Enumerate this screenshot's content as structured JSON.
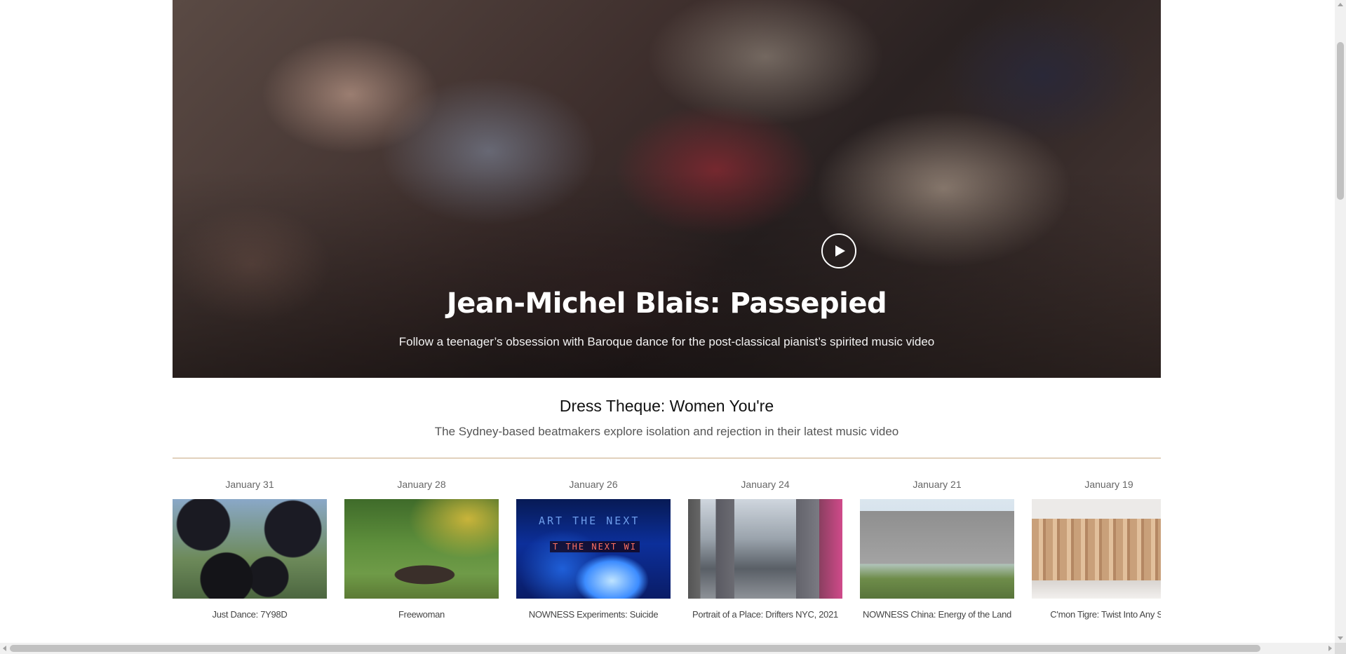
{
  "hero": {
    "title": "Jean-Michel Blais: Passepied",
    "subtitle": "Follow a teenager’s obsession with Baroque dance for the post-classical pianist’s spirited music video",
    "play_icon": "play-icon"
  },
  "feature": {
    "title": "Dress Theque: Women You're",
    "subtitle": "The Sydney-based beatmakers explore isolation and rejection in their latest music video"
  },
  "carousel": {
    "items": [
      {
        "date": "January 31",
        "title": "Just Dance: 7Y98D"
      },
      {
        "date": "January 28",
        "title": "Freewoman"
      },
      {
        "date": "January 26",
        "title": "NOWNESS Experiments: Suicide",
        "thumb_text_1": "ART THE NEXT",
        "thumb_text_2": "T THE NEXT WI"
      },
      {
        "date": "January 24",
        "title": "Portrait of a Place: Drifters NYC, 2021"
      },
      {
        "date": "January 21",
        "title": "NOWNESS China: Energy of the Land"
      },
      {
        "date": "January 19",
        "title": "C'mon Tigre: Twist Into Any Sh"
      }
    ]
  },
  "colors": {
    "divider": "#c7a883",
    "date_text": "#666666",
    "subtitle_text": "#555555"
  }
}
